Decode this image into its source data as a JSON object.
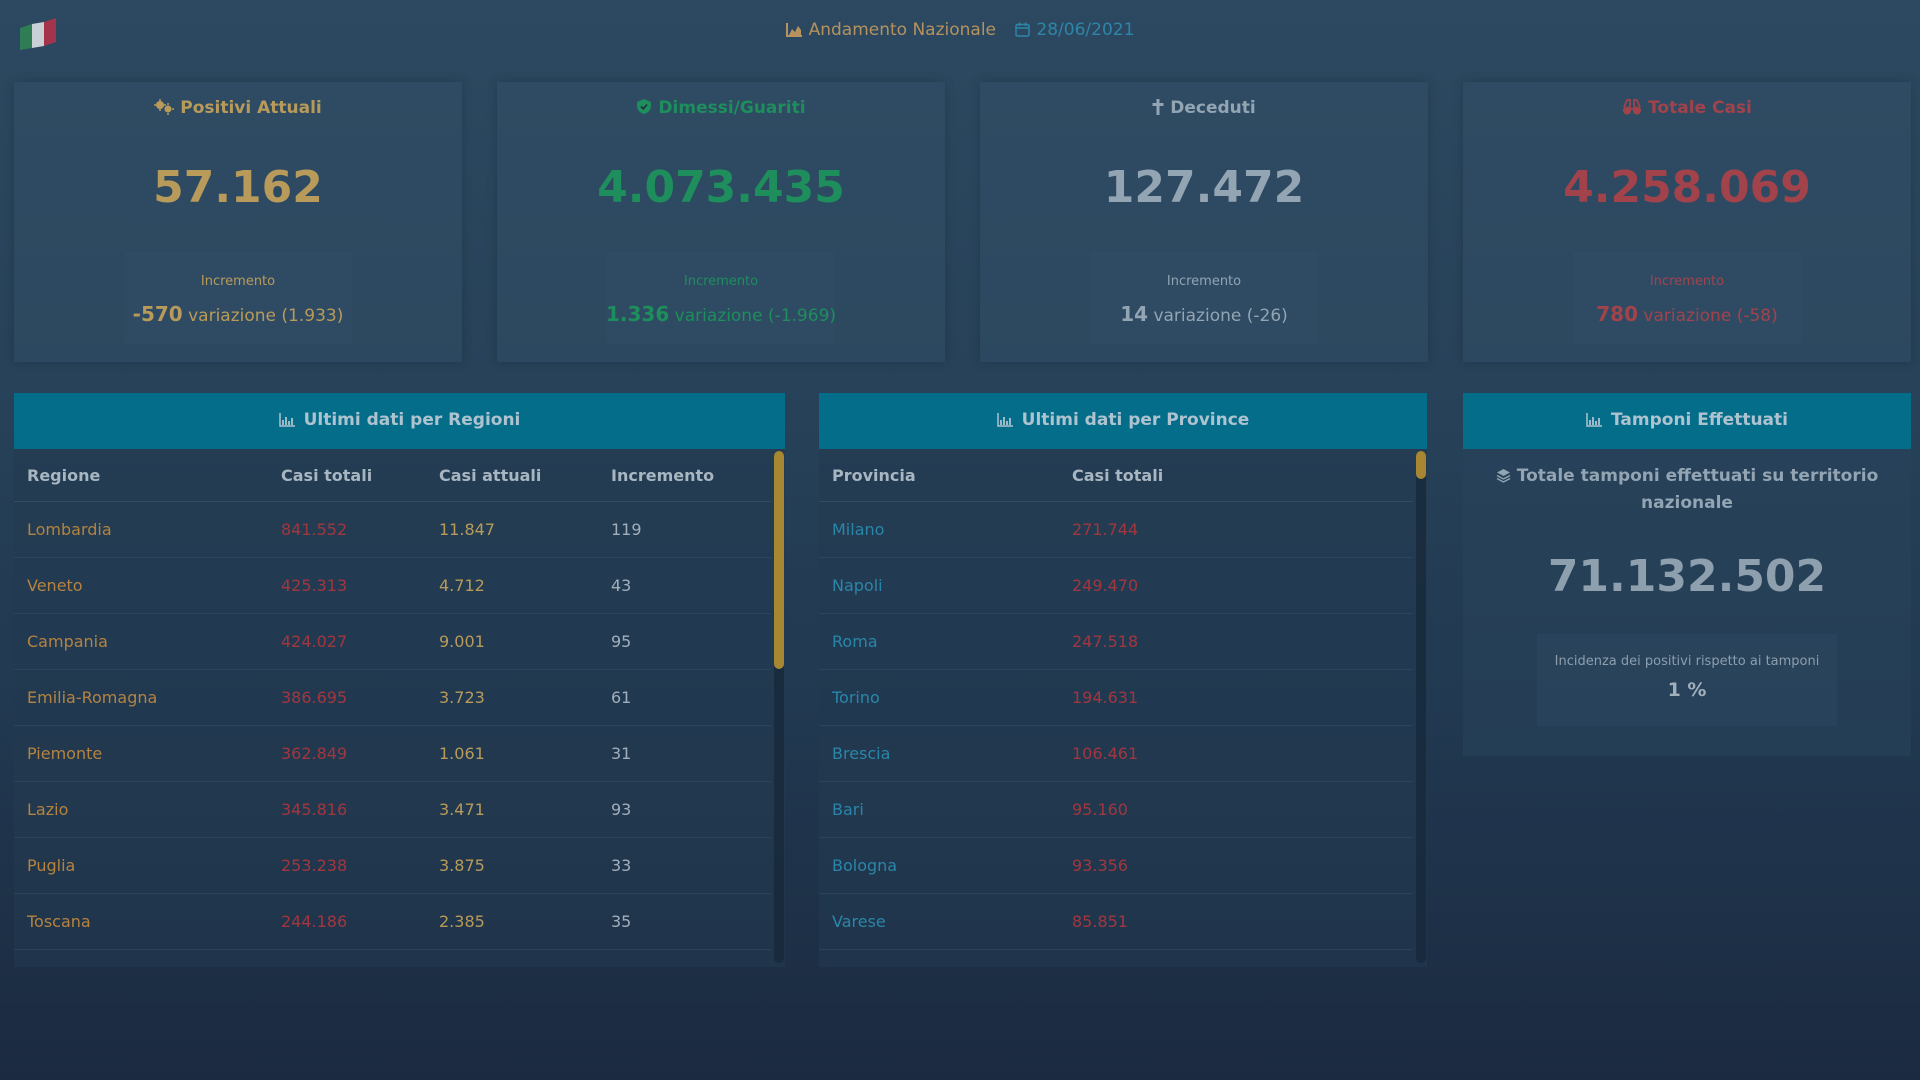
{
  "header": {
    "title": "Andamento Nazionale",
    "date": "28/06/2021"
  },
  "cards": [
    {
      "title": "Positivi Attuali",
      "value": "57.162",
      "increment_label": "Incremento",
      "increment": "-570",
      "variation": "variazione (1.933)",
      "color": "#b89b5a",
      "icon": "virus-icon"
    },
    {
      "title": "Dimessi/Guariti",
      "value": "4.073.435",
      "increment_label": "Incremento",
      "increment": "1.336",
      "variation": "variazione (-1.969)",
      "color": "#1d8e5c",
      "icon": "shield-icon"
    },
    {
      "title": "Deceduti",
      "value": "127.472",
      "increment_label": "Incremento",
      "increment": "14",
      "variation": "variazione (-26)",
      "color": "#93a4b3",
      "icon": "cross-icon"
    },
    {
      "title": "Totale Casi",
      "value": "4.258.069",
      "increment_label": "Incremento",
      "increment": "780",
      "variation": "variazione (-58)",
      "color": "#a2434b",
      "icon": "binoculars-icon"
    }
  ],
  "regioni": {
    "title": "Ultimi dati per Regioni",
    "columns": [
      "Regione",
      "Casi totali",
      "Casi attuali",
      "Incremento"
    ],
    "rows": [
      [
        "Lombardia",
        "841.552",
        "11.847",
        "119"
      ],
      [
        "Veneto",
        "425.313",
        "4.712",
        "43"
      ],
      [
        "Campania",
        "424.027",
        "9.001",
        "95"
      ],
      [
        "Emilia-Romagna",
        "386.695",
        "3.723",
        "61"
      ],
      [
        "Piemonte",
        "362.849",
        "1.061",
        "31"
      ],
      [
        "Lazio",
        "345.816",
        "3.471",
        "93"
      ],
      [
        "Puglia",
        "253.238",
        "3.875",
        "33"
      ],
      [
        "Toscana",
        "244.186",
        "2.385",
        "35"
      ]
    ]
  },
  "province": {
    "title": "Ultimi dati per Province",
    "columns": [
      "Provincia",
      "Casi totali"
    ],
    "rows": [
      [
        "Milano",
        "271.744"
      ],
      [
        "Napoli",
        "249.470"
      ],
      [
        "Roma",
        "247.518"
      ],
      [
        "Torino",
        "194.631"
      ],
      [
        "Brescia",
        "106.461"
      ],
      [
        "Bari",
        "95.160"
      ],
      [
        "Bologna",
        "93.356"
      ],
      [
        "Varese",
        "85.851"
      ]
    ]
  },
  "tamponi": {
    "title": "Tamponi Effettuati",
    "subtitle": "Totale tamponi effettuati su territorio nazionale",
    "value": "71.132.502",
    "incidence_label": "Incidenza dei positivi rispetto ai tamponi",
    "incidence_value": "1 %"
  }
}
